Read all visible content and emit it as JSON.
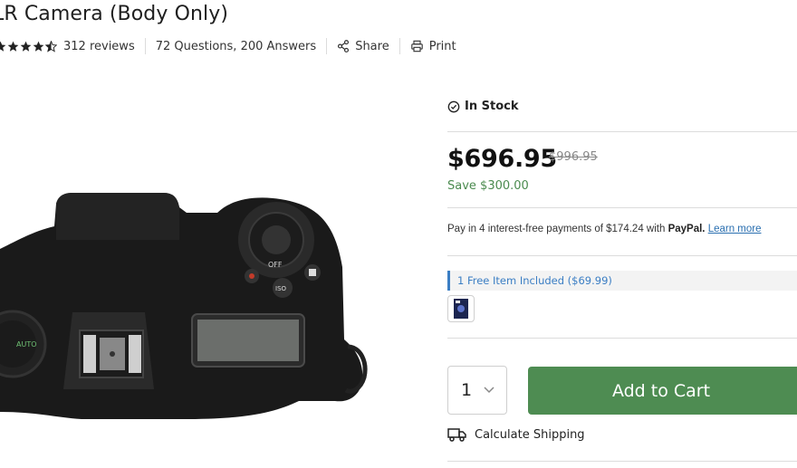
{
  "product": {
    "title": "LR Camera (Body Only)",
    "rating": 4.5,
    "reviews": "312 reviews",
    "questions": "72 Questions, 200 Answers",
    "share_label": "Share",
    "print_label": "Print"
  },
  "purchase": {
    "stock_status": "In Stock",
    "price": "$696.95",
    "old_price": "$996.95",
    "savings": "Save $300.00",
    "paypal_text": "Pay in 4 interest-free payments of $174.24 with",
    "paypal_brand": "PayPal.",
    "paypal_link": "Learn more",
    "free_item": "1 Free Item Included ($69.99)",
    "quantity": "1",
    "add_to_cart": "Add to Cart",
    "shipping_label": "Calculate Shipping"
  },
  "colors": {
    "accent_green": "#4e8c52",
    "link_blue": "#2a6fb0",
    "save_green": "#4b8b4f"
  }
}
